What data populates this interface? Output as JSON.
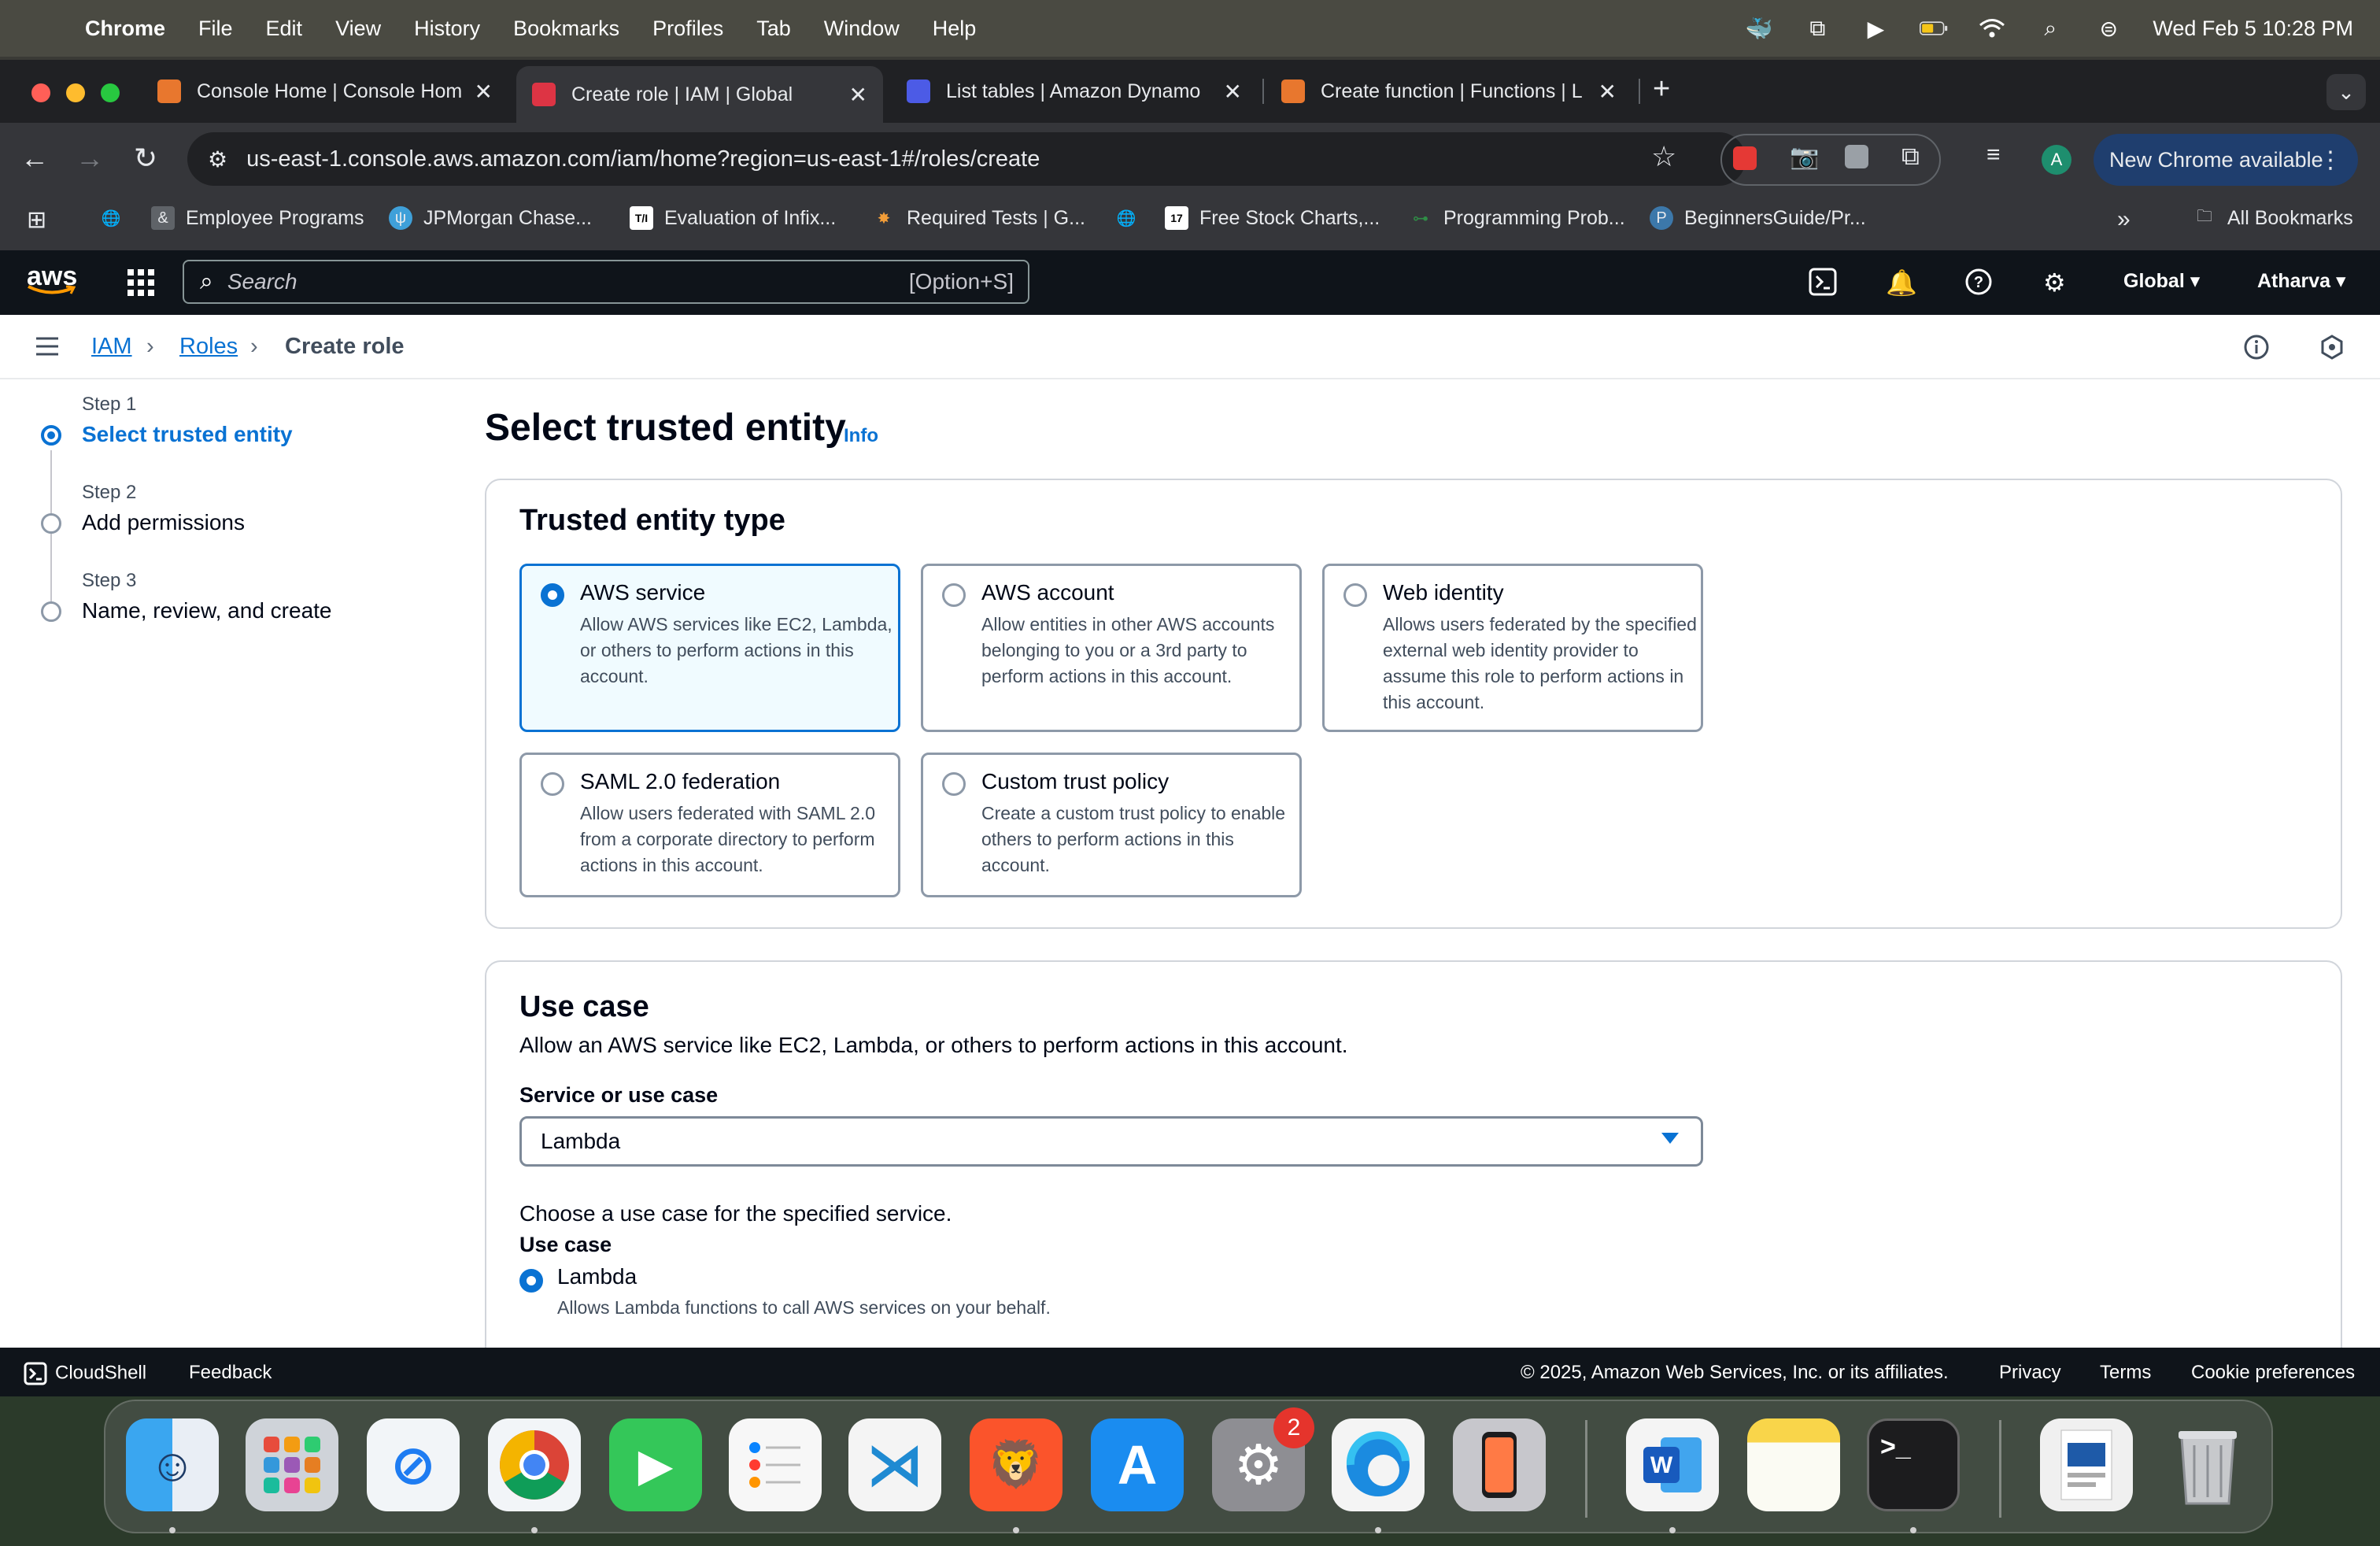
{
  "menubar": {
    "app": "Chrome",
    "items": [
      "File",
      "Edit",
      "View",
      "History",
      "Bookmarks",
      "Profiles",
      "Tab",
      "Window",
      "Help"
    ],
    "datetime": "Wed Feb 5  10:28 PM"
  },
  "tabs": [
    {
      "title": "Console Home | Console Hom",
      "color": "#e8772e"
    },
    {
      "title": "Create role | IAM | Global",
      "color": "#dd3444"
    },
    {
      "title": "List tables | Amazon Dynamo",
      "color": "#4c5be6"
    },
    {
      "title": "Create function | Functions | L",
      "color": "#e8772e"
    }
  ],
  "toolbar": {
    "url": "us-east-1.console.aws.amazon.com/iam/home?region=us-east-1#/roles/create",
    "new_chrome": "New Chrome available",
    "profile_initial": "A"
  },
  "bookmarks": [
    "Employee Programs",
    "JPMorgan Chase...",
    "Evaluation of Infix...",
    "Required Tests | G...",
    "Free Stock Charts,...",
    "Programming Prob...",
    "BeginnersGuide/Pr..."
  ],
  "all_bookmarks": "All Bookmarks",
  "aws": {
    "logo": "aws",
    "search_placeholder": "Search",
    "search_shortcut": "[Option+S]",
    "region": "Global",
    "user": "Atharva"
  },
  "breadcrumb": {
    "iam": "IAM",
    "roles": "Roles",
    "current": "Create role"
  },
  "steps": [
    {
      "label": "Step 1",
      "title": "Select trusted entity"
    },
    {
      "label": "Step 2",
      "title": "Add permissions"
    },
    {
      "label": "Step 3",
      "title": "Name, review, and create"
    }
  ],
  "heading": {
    "title": "Select trusted entity",
    "info": "Info"
  },
  "trusted": {
    "title": "Trusted entity type",
    "tiles": [
      {
        "title": "AWS service",
        "desc": "Allow AWS services like EC2, Lambda, or others to perform actions in this account."
      },
      {
        "title": "AWS account",
        "desc": "Allow entities in other AWS accounts belonging to you or a 3rd party to perform actions in this account."
      },
      {
        "title": "Web identity",
        "desc": "Allows users federated by the specified external web identity provider to assume this role to perform actions in this account."
      },
      {
        "title": "SAML 2.0 federation",
        "desc": "Allow users federated with SAML 2.0 from a corporate directory to perform actions in this account."
      },
      {
        "title": "Custom trust policy",
        "desc": "Create a custom trust policy to enable others to perform actions in this account."
      }
    ]
  },
  "usecase": {
    "title": "Use case",
    "desc": "Allow an AWS service like EC2, Lambda, or others to perform actions in this account.",
    "service_label": "Service or use case",
    "service_value": "Lambda",
    "choose_text": "Choose a use case for the specified service.",
    "usecase_label": "Use case",
    "option_title": "Lambda",
    "option_desc": "Allows Lambda functions to call AWS services on your behalf."
  },
  "footer": {
    "cloudshell": "CloudShell",
    "feedback": "Feedback",
    "copyright": "© 2025, Amazon Web Services, Inc. or its affiliates.",
    "privacy": "Privacy",
    "terms": "Terms",
    "cookies": "Cookie preferences"
  },
  "dock": {
    "settings_badge": "2"
  },
  "colors": {
    "accent": "#0972d3",
    "aws_nav": "#0f141a",
    "selected_tile_bg": "#f0fbff"
  }
}
